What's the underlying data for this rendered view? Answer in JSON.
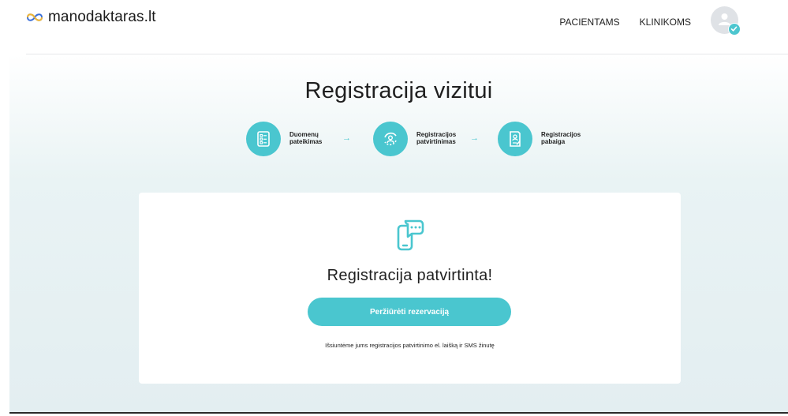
{
  "header": {
    "logo_text": "manodaktaras.lt",
    "nav": [
      {
        "label": "PACIENTAMS"
      },
      {
        "label": "KLINIKOMS"
      }
    ]
  },
  "page": {
    "title": "Registracija vizitui",
    "steps": [
      {
        "label_line1": "Duomenų",
        "label_line2": "pateikimas",
        "icon": "form-list-icon"
      },
      {
        "label_line1": "Registracijos",
        "label_line2": "patvirtinimas",
        "icon": "user-refresh-icon"
      },
      {
        "label_line1": "Registracijos",
        "label_line2": "pabaiga",
        "icon": "document-pen-icon"
      }
    ],
    "arrow_glyph": "→"
  },
  "card": {
    "icon": "phone-chat-icon",
    "title": "Registracija patvirtinta!",
    "button_label": "Peržiūrėti rezervaciją",
    "note": "Išsiuntėme jums registracijos patvirtinimo el. laišką ir SMS žinutę"
  },
  "colors": {
    "accent": "#4ac6cf",
    "background_gradient_end": "#e3eef1"
  }
}
